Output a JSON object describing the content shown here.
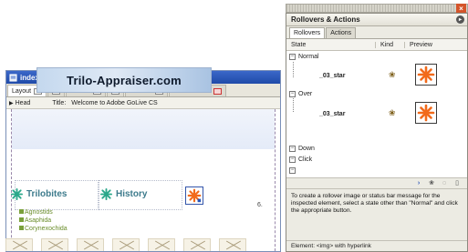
{
  "document": {
    "title": "index.html *",
    "tabs": [
      {
        "label": "Layout",
        "active": true
      },
      {
        "label": "",
        "active": false
      },
      {
        "label": "Source",
        "active": false
      },
      {
        "label": "",
        "active": false
      },
      {
        "label": "Preview",
        "active": false
      },
      {
        "label": "PDF Preview",
        "active": false
      }
    ],
    "head_label": "Head",
    "title_label": "Title:",
    "title_value": "Welcome to Adobe GoLive CS",
    "banner": "Trilo-Appraiser.com",
    "nav": {
      "item1": "Trilobites",
      "item2": "History"
    },
    "sublinks": [
      "Agnostids",
      "Asaphida",
      "Corynexochida"
    ],
    "dim_label": "6."
  },
  "palette": {
    "title": "Rollovers & Actions",
    "tabs": [
      "Rollovers",
      "Actions"
    ],
    "columns": {
      "state": "State",
      "kind": "Kind",
      "preview": "Preview"
    },
    "states": [
      {
        "label": "Normal",
        "expanded": true,
        "element": "_03_star"
      },
      {
        "label": "Over",
        "expanded": true,
        "element": "_03_star"
      },
      {
        "label": "Down",
        "expanded": false
      },
      {
        "label": "Click",
        "expanded": false
      }
    ],
    "hint": "To create a rollover image or status bar message for the inspected element, select a state other than \"Normal\" and click the appropriate button.",
    "status": "Element: <img> with hyperlink"
  },
  "colors": {
    "star_orange": "#f26a1b",
    "title_blue": "#2a56b8",
    "nav_teal": "#3d7b8c"
  }
}
